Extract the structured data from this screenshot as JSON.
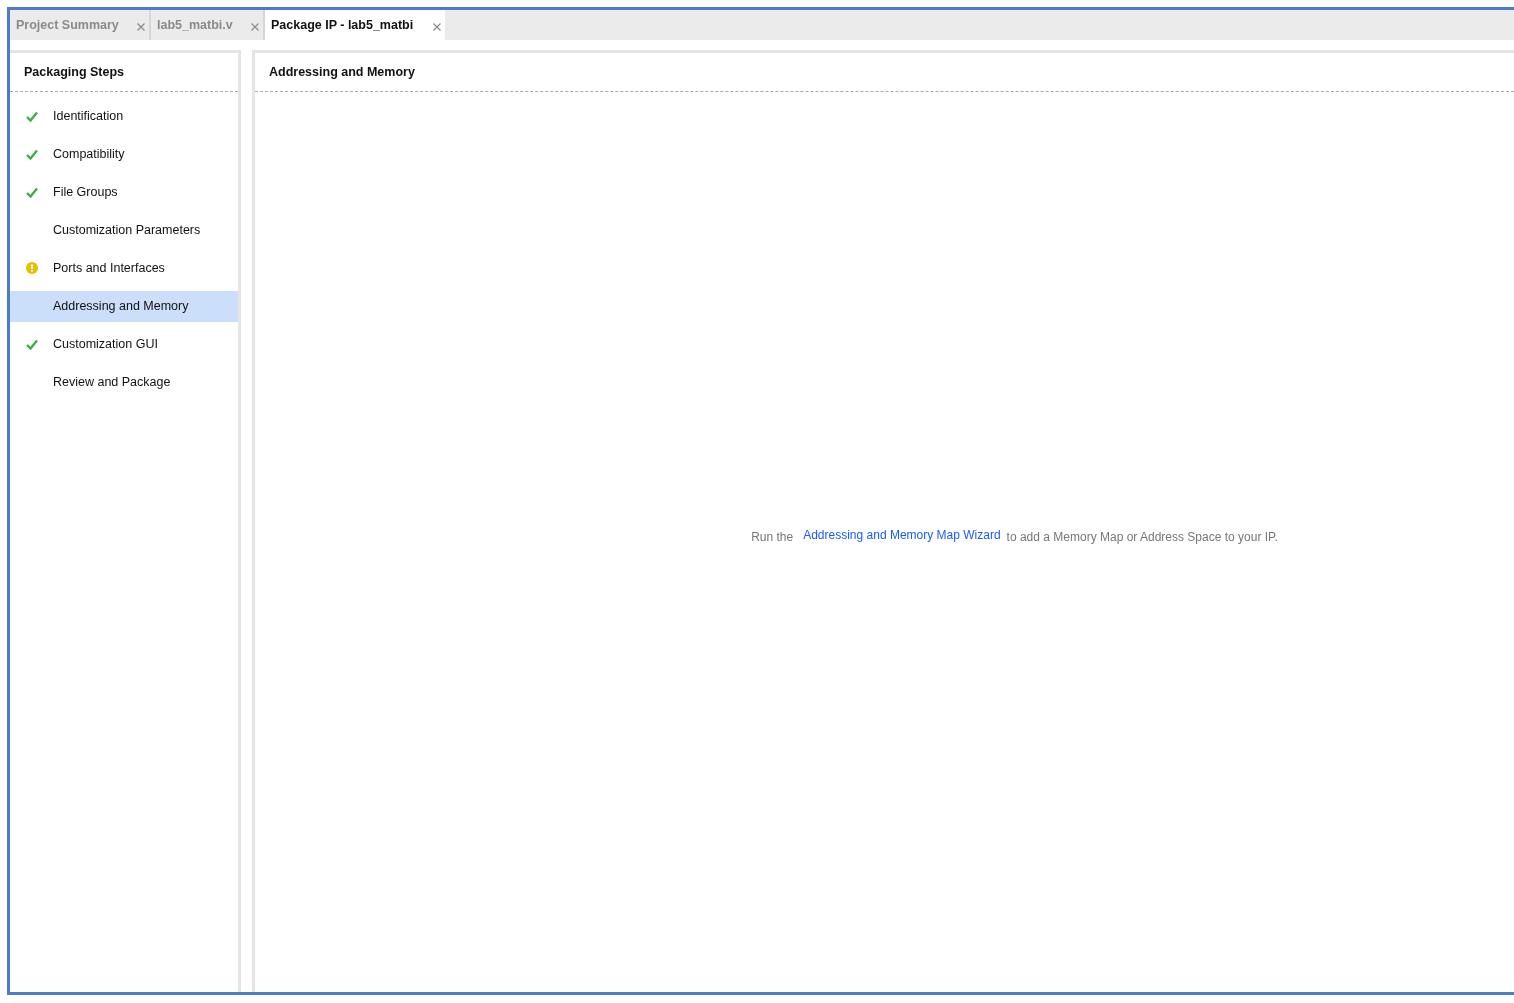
{
  "tabs": [
    {
      "label": "Project Summary",
      "selected": false
    },
    {
      "label": "lab5_matbi.v",
      "selected": false
    },
    {
      "label": "Package IP - lab5_matbi",
      "selected": true
    }
  ],
  "sidebar": {
    "title": "Packaging Steps",
    "items": [
      {
        "label": "Identification",
        "kind": "done",
        "selected": false
      },
      {
        "label": "Compatibility",
        "kind": "done",
        "selected": false
      },
      {
        "label": "File Groups",
        "kind": "done",
        "selected": false
      },
      {
        "label": "Customization Parameters",
        "kind": "plain",
        "selected": false
      },
      {
        "label": "Ports and Interfaces",
        "kind": "warning",
        "selected": false
      },
      {
        "label": "Addressing and Memory",
        "kind": "plain",
        "selected": true
      },
      {
        "label": "Customization GUI",
        "kind": "done",
        "selected": false
      },
      {
        "label": "Review and Package",
        "kind": "plain",
        "selected": false
      }
    ]
  },
  "main": {
    "title": "Addressing and Memory",
    "message": {
      "before": "Run the",
      "link": "Addressing and Memory Map Wizard",
      "after": "to add a Memory Map or Address Space to your IP."
    }
  }
}
